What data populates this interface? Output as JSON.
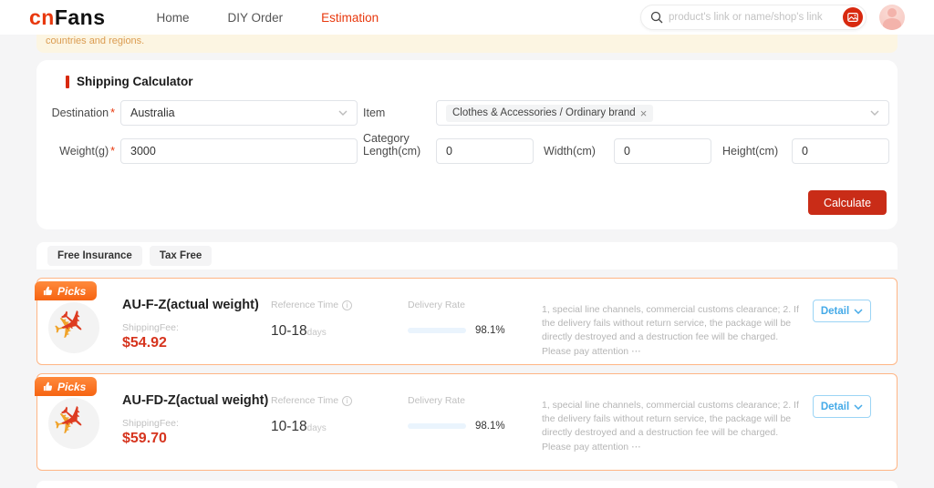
{
  "header": {
    "logo": {
      "part1": "cn",
      "part2": "Fans"
    },
    "nav": [
      {
        "label": "Home",
        "active": false
      },
      {
        "label": "DIY Order",
        "active": false
      },
      {
        "label": "Estimation",
        "active": true
      }
    ],
    "search": {
      "placeholder": "product's link or name/shop's link"
    }
  },
  "banner": {
    "text": "countries and regions."
  },
  "calculator": {
    "title": "Shipping Calculator",
    "required_mark": "*",
    "destination": {
      "label": "Destination",
      "value": "Australia"
    },
    "item_category": {
      "label": "Item Category",
      "tag": "Clothes & Accessories / Ordinary brand",
      "remove_icon": "×"
    },
    "weight": {
      "label": "Weight(g)",
      "value": "3000"
    },
    "length": {
      "label": "Length(cm)",
      "value": "0"
    },
    "width": {
      "label": "Width(cm)",
      "value": "0"
    },
    "height": {
      "label": "Height(cm)",
      "value": "0"
    },
    "calculate_label": "Calculate"
  },
  "results": {
    "tabs": [
      {
        "label": "Free Insurance"
      },
      {
        "label": "Tax Free"
      }
    ],
    "cards": [
      {
        "badge": "Picks",
        "name": "AU-F-Z(actual weight)",
        "fee_label": "ShippingFee:",
        "fee": "$54.92",
        "reference_time_label": "Reference Time",
        "reference_time": "10-18",
        "reference_time_unit": "days",
        "delivery_rate_label": "Delivery Rate",
        "delivery_rate_percent": 98.1,
        "delivery_rate_text": "98.1%",
        "note": "1, special line channels, commercial customs clearance; 2. If the delivery fails without return service, the package will be directly destroyed and a destruction fee will be charged. Please pay attention ⋯",
        "detail_label": "Detail"
      },
      {
        "badge": "Picks",
        "name": "AU-FD-Z(actual weight)",
        "fee_label": "ShippingFee:",
        "fee": "$59.70",
        "reference_time_label": "Reference Time",
        "reference_time": "10-18",
        "reference_time_unit": "days",
        "delivery_rate_label": "Delivery Rate",
        "delivery_rate_percent": 98.1,
        "delivery_rate_text": "98.1%",
        "note": "1, special line channels, commercial customs clearance; 2. If the delivery fails without return service, the package will be directly destroyed and a destruction fee will be charged. Please pay attention ⋯",
        "detail_label": "Detail"
      }
    ]
  },
  "icons": {
    "plane": "✈",
    "info": "i",
    "close": "×"
  },
  "colors": {
    "brand_red": "#e8380d",
    "button_red": "#c92c17",
    "price_red": "#d6341e",
    "badge_orange": "#f66412",
    "card_border": "#ffb584",
    "detail_blue": "#45aae8",
    "rate_blue": "#3ba4f2",
    "banner_bg": "#fcf5e2",
    "banner_text": "#db9c51"
  }
}
